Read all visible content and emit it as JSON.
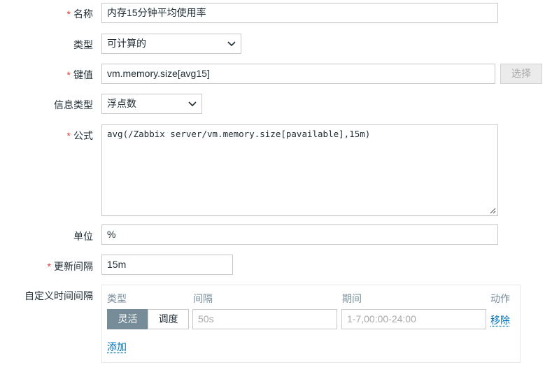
{
  "form": {
    "name": {
      "label": "名称",
      "value": "内存15分钟平均使用率"
    },
    "type": {
      "label": "类型",
      "value": "可计算的"
    },
    "key": {
      "label": "键值",
      "value": "vm.memory.size[avg15]",
      "button": "选择"
    },
    "info_type": {
      "label": "信息类型",
      "value": "浮点数"
    },
    "formula": {
      "label": "公式",
      "value": "avg(/Zabbix server/vm.memory.size[pavailable],15m)"
    },
    "units": {
      "label": "单位",
      "value": "%"
    },
    "update_interval": {
      "label": "更新间隔",
      "value": "15m"
    },
    "custom_intervals": {
      "label": "自定义时间间隔",
      "headers": {
        "type": "类型",
        "interval": "间隔",
        "period": "期间",
        "action": "动作"
      },
      "row": {
        "mode_flexible": "灵活",
        "mode_scheduling": "调度",
        "interval_placeholder": "50s",
        "period_placeholder": "1-7,00:00-24:00",
        "remove": "移除"
      },
      "add": "添加"
    }
  },
  "colors": {
    "required": "#e33734",
    "link": "#0275b8",
    "active_segment": "#768d99"
  }
}
